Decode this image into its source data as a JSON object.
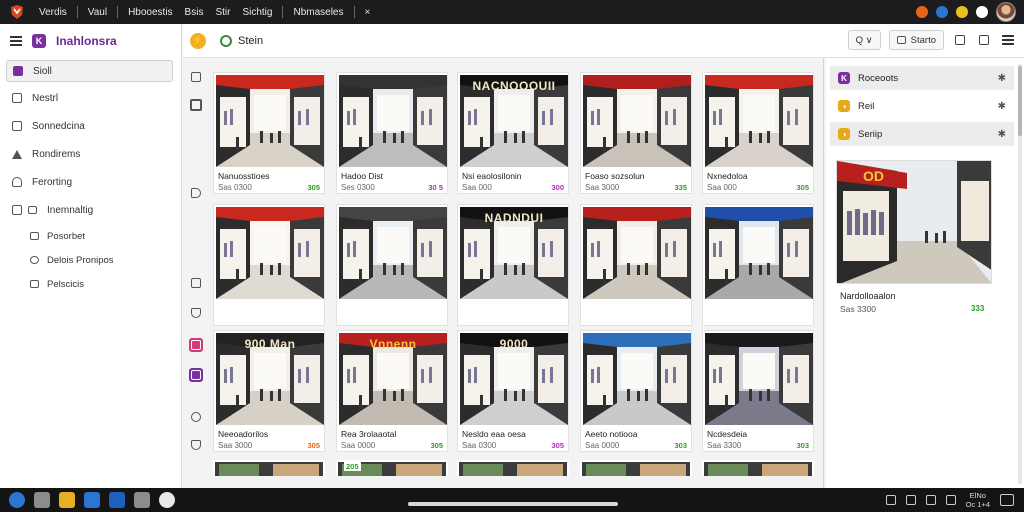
{
  "topbar": {
    "menus": [
      "Verdis",
      "Vaul",
      "Hbooestis",
      "Bsis",
      "Stir",
      "Sichtig",
      "Nbmaseles"
    ],
    "close_glyph": "×",
    "status_colors": [
      "#e8641c",
      "#2a76d2",
      "#e8c21c",
      "#ffffff"
    ]
  },
  "sidebar": {
    "brand": "Inahlonsra",
    "brand_letter": "K",
    "items": [
      {
        "label": "Sioll",
        "active": true
      },
      {
        "label": "Nestrl"
      },
      {
        "label": "Sonnedcina"
      },
      {
        "label": "Rondirems"
      },
      {
        "label": "Ferorting"
      },
      {
        "label": "Inemnaltig"
      }
    ],
    "subitems": [
      {
        "label": "Posorbet"
      },
      {
        "label": "Delois Pronipos"
      },
      {
        "label": "Pelscicis"
      }
    ]
  },
  "header": {
    "title": "Stein",
    "search_button": "Q ∨",
    "filter_button": "Starto"
  },
  "grid": {
    "cards": [
      {
        "name": "Nanuosstioes",
        "price": "Sas 0300",
        "badge": "305",
        "badge_color": "#2a9d2a",
        "sign": "",
        "sign_bg": "#c8281e",
        "floor": "#d9d2c6",
        "tone": "#f2efe8"
      },
      {
        "name": "Hadoo Dist",
        "price": "Ses 0300",
        "badge": "30 5",
        "badge_color": "#b12fb1",
        "sign": "",
        "sign_bg": "#333333",
        "floor": "#bdbdbd",
        "tone": "#e8ecef"
      },
      {
        "name": "Nsi eaolosilonin",
        "price": "Saa 000",
        "badge": "300",
        "badge_color": "#b12fb1",
        "sign": "NACNOOOUII",
        "sign_bg": "#111111",
        "floor": "#cfcfcf",
        "tone": "#eeeeee"
      },
      {
        "name": "Foaso sozsolun",
        "price": "Saa 3000",
        "badge": "335",
        "badge_color": "#2a9d2a",
        "sign": "",
        "sign_bg": "#b01e1e",
        "floor": "#c9c2b8",
        "tone": "#f4f0ea"
      },
      {
        "name": "Nxnedoloa",
        "price": "Saa 000",
        "badge": "305",
        "badge_color": "#2a9d2a",
        "sign": "",
        "sign_bg": "#c8281e",
        "floor": "#d8d2ca",
        "tone": "#f5f2ee"
      },
      {
        "name": "",
        "price": "",
        "badge": "",
        "badge_color": "#2a9d2a",
        "sign": "",
        "sign_bg": "#c8281e",
        "floor": "#e0dbd2",
        "tone": "#f8f5ef"
      },
      {
        "name": "",
        "price": "",
        "badge": "",
        "badge_color": "#2a9d2a",
        "sign": "",
        "sign_bg": "#444444",
        "floor": "#b8b8b8",
        "tone": "#eaeff3"
      },
      {
        "name": "",
        "price": "",
        "badge": "",
        "badge_color": "#2a9d2a",
        "sign": "NADNDUI",
        "sign_bg": "#111111",
        "floor": "#c9c9c9",
        "tone": "#efefef"
      },
      {
        "name": "",
        "price": "",
        "badge": "",
        "badge_color": "#2a9d2a",
        "sign": "",
        "sign_bg": "#b8201e",
        "floor": "#cfc8be",
        "tone": "#f2ede6"
      },
      {
        "name": "",
        "price": "",
        "badge": "",
        "badge_color": "#2a9d2a",
        "sign": "",
        "sign_bg": "#1f4fa8",
        "floor": "#a9a9a9",
        "tone": "#dfe8ef"
      },
      {
        "name": "Neeoadorilos",
        "price": "Saa 3000",
        "badge": "305",
        "badge_color": "#e8641c",
        "sign": "900 Man",
        "sign_bg": "#222222",
        "floor": "#d6d0c6",
        "tone": "#f3f0ea"
      },
      {
        "name": "Rea 3rolaaotal",
        "price": "Saa 0000",
        "badge": "305",
        "badge_color": "#2a9d2a",
        "sign": "Vnnenn",
        "sign_bg": "#b8201e",
        "floor": "#c2bbb2",
        "tone": "#ece8e2"
      },
      {
        "name": "Nesldo eaa oesa",
        "price": "Saa 0300",
        "badge": "305",
        "badge_color": "#b12fb1",
        "sign": "9000",
        "sign_bg": "#111111",
        "floor": "#cfcfcf",
        "tone": "#efefef"
      },
      {
        "name": "Aeeto notiooa",
        "price": "Saa 0000",
        "badge": "303",
        "badge_color": "#2a9d2a",
        "sign": "",
        "sign_bg": "#2d6fb8",
        "floor": "#c9c9c9",
        "tone": "#e6eef3"
      },
      {
        "name": "Ncdesdeia",
        "price": "Saa 3300",
        "badge": "303",
        "badge_color": "#2a9d2a",
        "sign": "",
        "sign_bg": "#1a1a1a",
        "floor": "#7a7a8a",
        "tone": "#cfd2dc"
      }
    ],
    "partial_badges": [
      "",
      "205",
      "",
      "",
      ""
    ]
  },
  "rpanel": {
    "items": [
      {
        "label": "Roceoots",
        "icon_color": "#7b2f9e",
        "icon_letter": "K"
      },
      {
        "label": "Reil",
        "icon_color": "#e8a817",
        "icon_letter": "◑"
      },
      {
        "label": "Seriip",
        "icon_color": "#e8a817",
        "icon_letter": "◑"
      }
    ],
    "pin_glyph": "✱",
    "card": {
      "name": "Nardolloaalon",
      "price": "Sas 3300",
      "badge": "333",
      "sign": "OD"
    }
  },
  "taskbar": {
    "icons": [
      {
        "color": "#2a76d2"
      },
      {
        "color": "#8c8c8c"
      },
      {
        "color": "#e8b020"
      },
      {
        "color": "#2a76d2"
      },
      {
        "color": "#1f5fbf"
      },
      {
        "color": "#8c8c8c"
      },
      {
        "color": "#e8e8e8"
      }
    ],
    "clock_time": "ElNo",
    "clock_date": "Oc 1+4"
  }
}
